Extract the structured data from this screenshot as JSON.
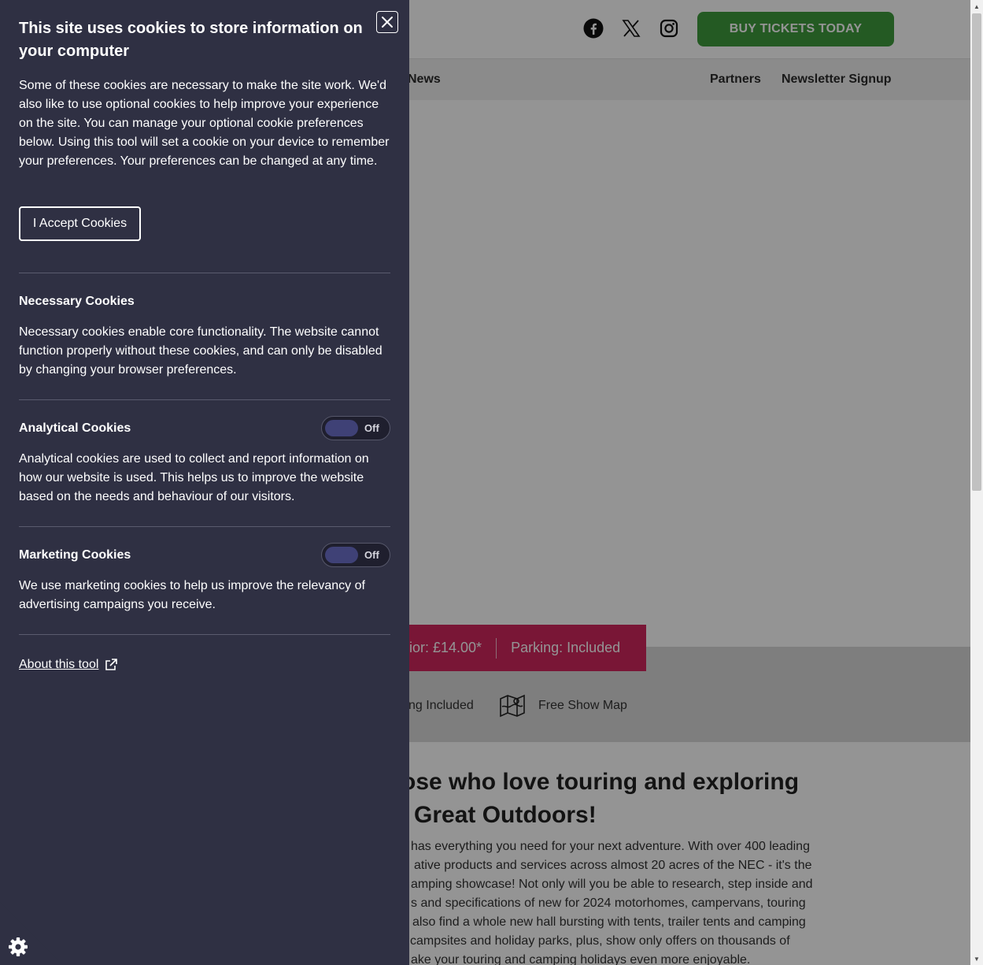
{
  "header": {
    "buy_tickets_label": "BUY TICKETS TODAY",
    "social_icons": [
      "facebook-icon",
      "x-icon",
      "instagram-icon"
    ],
    "buy_button_color": "#3f9b3d"
  },
  "nav": {
    "items": [
      {
        "label": "News"
      },
      {
        "label": "Partners"
      },
      {
        "label": "Newsletter Signup"
      }
    ]
  },
  "price_banner": {
    "price_fragment": "ior: £14.00*",
    "parking": "Parking: Included",
    "color": "#d0265d"
  },
  "features": {
    "items": [
      {
        "label": "ng Included"
      },
      {
        "label": "Free Show Map",
        "icon": "map-icon"
      }
    ]
  },
  "content": {
    "headline_line1": "ose who love touring and exploring",
    "headline_line2": "Great Outdoors!",
    "body_lines": [
      "has everything you need for your next adventure. With over 400 leading",
      "ative products and services across almost 20 acres of the NEC - it's the",
      "amping showcase! Not only will you be able to research, step inside and",
      "s and specifications of new for 2024 motorhomes, campervans, touring",
      "also find a whole new hall bursting with tents, trailer tents and camping",
      "campsites and holiday parks, plus, show only offers on thousands of",
      "ake your touring and camping holidays even more enjoyable."
    ]
  },
  "cookie_panel": {
    "title": "This site uses cookies to store information on your computer",
    "intro": "Some of these cookies are necessary to make the site work. We'd also like to use optional cookies to help improve your experience on the site. You can manage your optional cookie preferences below. Using this tool will set a cookie on your device to remember your preferences. Your preferences can be changed at any time.",
    "accept_label": "I Accept Cookies",
    "necessary": {
      "heading": "Necessary Cookies",
      "text": "Necessary cookies enable core functionality. The website cannot function properly without these cookies, and can only be disabled by changing your browser preferences."
    },
    "analytical": {
      "heading": "Analytical Cookies",
      "toggle_state": "Off",
      "text": "Analytical cookies are used to collect and report information on how our website is used. This helps us to improve the website based on the needs and behaviour of our visitors."
    },
    "marketing": {
      "heading": "Marketing Cookies",
      "toggle_state": "Off",
      "text": "We use marketing cookies to help us improve the relevancy of advertising campaigns you receive."
    },
    "about_label": "About this tool",
    "background_color": "#2f3043"
  }
}
